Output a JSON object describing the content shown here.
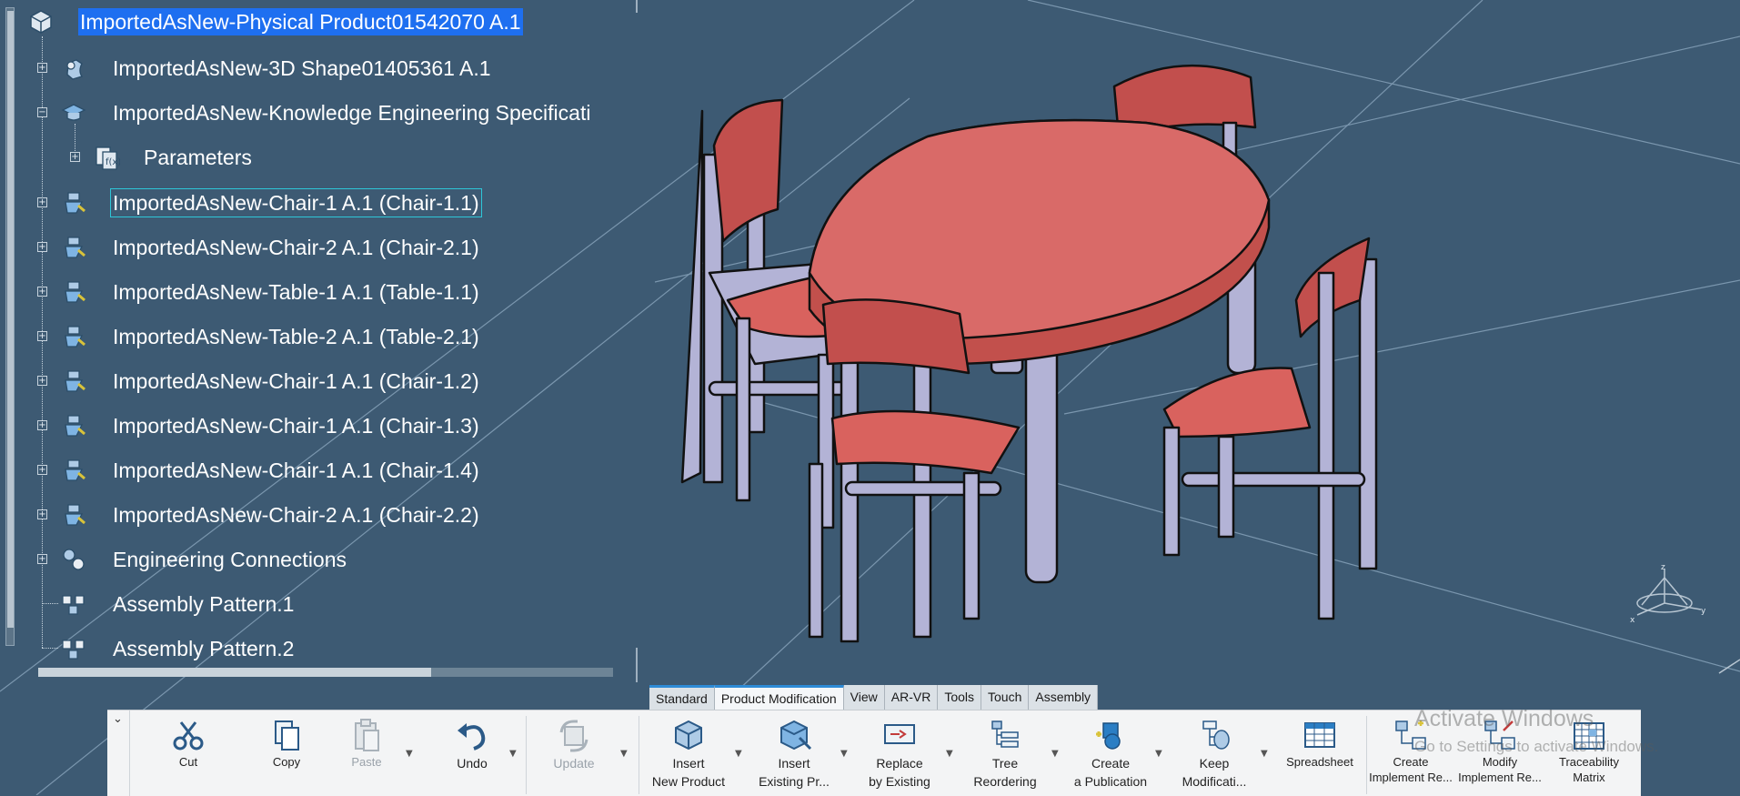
{
  "colors": {
    "background": "#3d5a73",
    "selection": "#1e6ff0",
    "focus_outline": "#2ec6d8",
    "table_top": "#d96a68",
    "chair_seat": "#d9625e",
    "leg_lavender": "#b3b3d6"
  },
  "tree": {
    "root": {
      "label": "ImportedAsNew-Physical Product01542070 A.1",
      "icon": "product-icon"
    },
    "nodes": [
      {
        "label": "ImportedAsNew-3D Shape01405361 A.1",
        "icon": "shape-icon",
        "expander": "+"
      },
      {
        "label": "ImportedAsNew-Knowledge Engineering Specificati",
        "icon": "knowledge-icon",
        "expander": "−"
      },
      {
        "label": "Parameters",
        "icon": "parameters-icon",
        "expander": "+"
      },
      {
        "label": "ImportedAsNew-Chair-1 A.1 (Chair-1.1)",
        "icon": "part-instance-icon",
        "expander": "+"
      },
      {
        "label": "ImportedAsNew-Chair-2 A.1 (Chair-2.1)",
        "icon": "part-instance-icon",
        "expander": "+"
      },
      {
        "label": "ImportedAsNew-Table-1 A.1 (Table-1.1)",
        "icon": "part-instance-icon",
        "expander": "+"
      },
      {
        "label": "ImportedAsNew-Table-2 A.1 (Table-2.1)",
        "icon": "part-instance-icon",
        "expander": "+"
      },
      {
        "label": "ImportedAsNew-Chair-1 A.1 (Chair-1.2)",
        "icon": "part-instance-icon",
        "expander": "+"
      },
      {
        "label": "ImportedAsNew-Chair-1 A.1 (Chair-1.3)",
        "icon": "part-instance-icon",
        "expander": "+"
      },
      {
        "label": "ImportedAsNew-Chair-1 A.1 (Chair-1.4)",
        "icon": "part-instance-icon",
        "expander": "+"
      },
      {
        "label": "ImportedAsNew-Chair-2 A.1 (Chair-2.2)",
        "icon": "part-instance-icon",
        "expander": "+"
      },
      {
        "label": "Engineering Connections",
        "icon": "engineering-connections-icon",
        "expander": "+"
      },
      {
        "label": "Assembly Pattern.1",
        "icon": "assembly-pattern-icon",
        "expander": ""
      },
      {
        "label": "Assembly Pattern.2",
        "icon": "assembly-pattern-icon",
        "expander": ""
      }
    ]
  },
  "tabs": [
    "Standard",
    "Product Modification",
    "View",
    "AR-VR",
    "Tools",
    "Touch",
    "Assembly"
  ],
  "ribbon": {
    "collapse_glyph": "⌄",
    "commands": [
      {
        "line1": "Cut",
        "line2": "",
        "icon": "scissors-icon"
      },
      {
        "line1": "Copy",
        "line2": "",
        "icon": "copy-icon"
      },
      {
        "line1": "Paste",
        "line2": "",
        "icon": "paste-icon"
      },
      {
        "line1": "Undo",
        "line2": "",
        "icon": "undo-icon"
      },
      {
        "line1": "Update",
        "line2": "",
        "icon": "update-icon"
      },
      {
        "line1": "Insert",
        "line2": "New Product",
        "icon": "insert-new-product-icon"
      },
      {
        "line1": "Insert",
        "line2": "Existing Pr...",
        "icon": "insert-existing-product-icon"
      },
      {
        "line1": "Replace",
        "line2": "by Existing",
        "icon": "replace-icon"
      },
      {
        "line1": "Tree",
        "line2": "Reordering",
        "icon": "tree-reorder-icon"
      },
      {
        "line1": "Create",
        "line2": "a Publication",
        "icon": "publication-icon"
      },
      {
        "line1": "Keep",
        "line2": "Modificati...",
        "icon": "keep-modification-icon"
      },
      {
        "line1": "Spreadsheet",
        "line2": "",
        "icon": "spreadsheet-icon"
      },
      {
        "line1": "Create",
        "line2": "Implement Re...",
        "icon": "create-implement-icon"
      },
      {
        "line1": "Modify",
        "line2": "Implement Re...",
        "icon": "modify-implement-icon"
      },
      {
        "line1": "Traceability",
        "line2": "Matrix",
        "icon": "traceability-matrix-icon"
      }
    ]
  },
  "watermark": {
    "line1": "Activate Windows",
    "line2": "Go to Settings to activate Windows."
  },
  "compass": {
    "x": "x",
    "y": "y",
    "z": "z"
  }
}
